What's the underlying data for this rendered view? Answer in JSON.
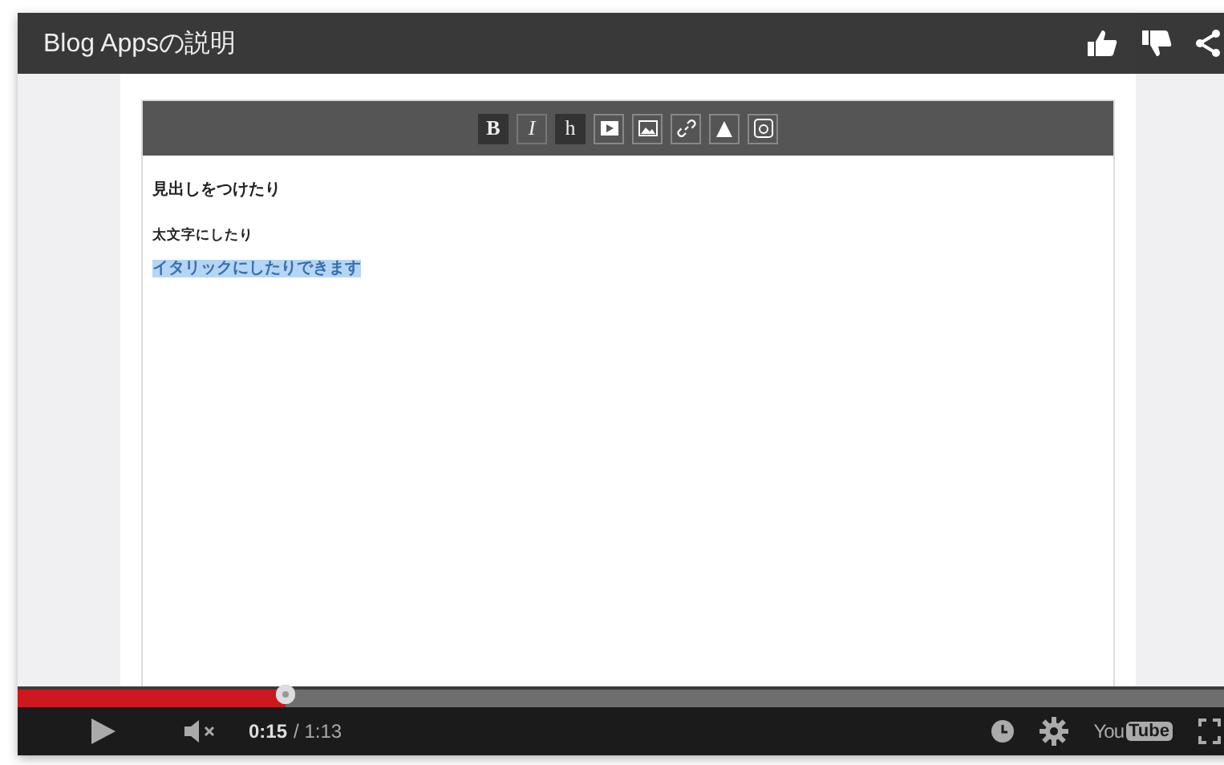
{
  "player": {
    "title": "Blog Appsの説明",
    "video": {
      "format_buttons": [
        "B",
        "I",
        "h"
      ],
      "heading": "見出しをつけたり",
      "bold_line": "太文字にしたり",
      "selected_line": "イタリックにしたりできます"
    },
    "progress": {
      "level": 0.217
    },
    "muted": true,
    "time_current": "0:15",
    "time_separator": "/ 1:13",
    "logo_you": "You",
    "logo_tube": "Tube"
  }
}
